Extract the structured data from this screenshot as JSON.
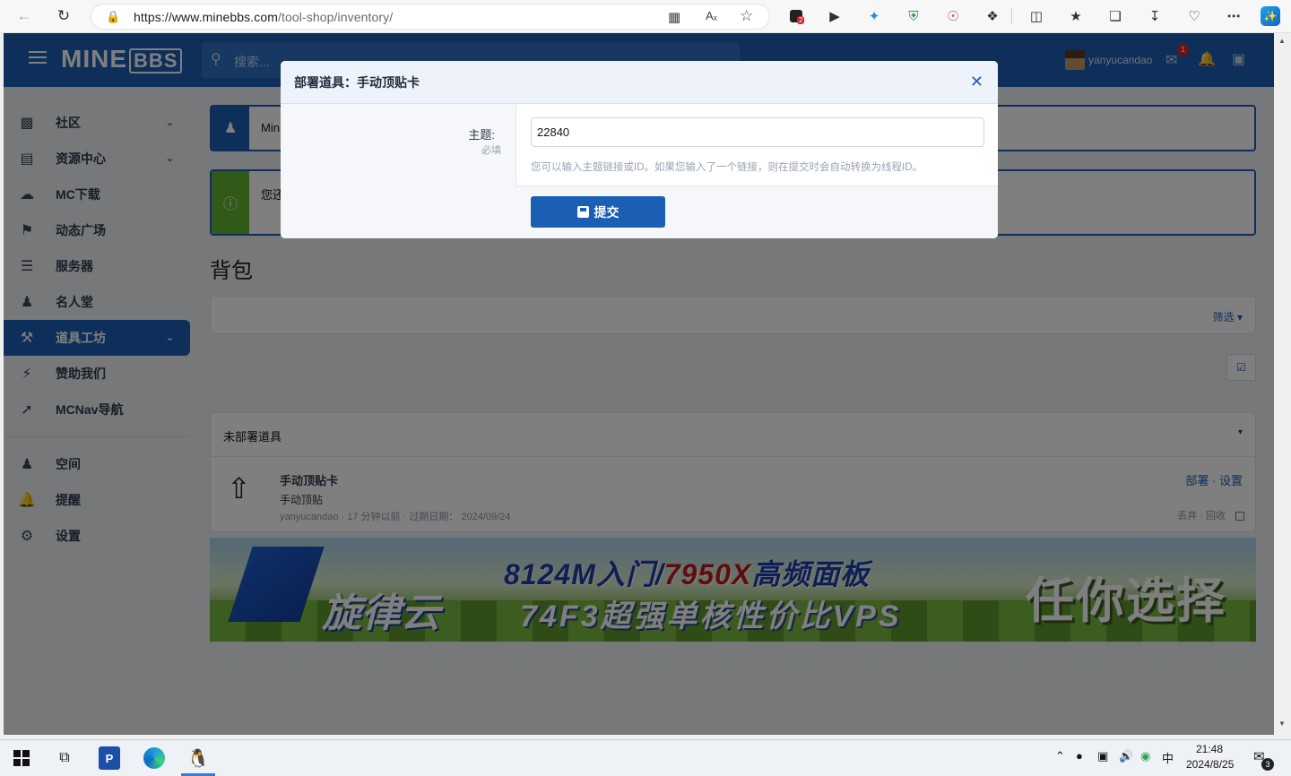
{
  "browser": {
    "url_host": "https://www.minebbs.com",
    "url_path": "/tool-shop/inventory/",
    "ext_badge": "2"
  },
  "header": {
    "logo_main": "MINE",
    "logo_box": "BBS",
    "search_placeholder": "搜索...",
    "username": "yanyucandao",
    "mail_badge": "1"
  },
  "sidebar": {
    "items": [
      {
        "label": "社区"
      },
      {
        "label": "资源中心"
      },
      {
        "label": "MC下载"
      },
      {
        "label": "动态广场"
      },
      {
        "label": "服务器"
      },
      {
        "label": "名人堂"
      },
      {
        "label": "道具工坊"
      },
      {
        "label": "赞助我们"
      },
      {
        "label": "MCNav导航"
      }
    ],
    "account": [
      {
        "label": "空间"
      },
      {
        "label": "提醒"
      },
      {
        "label": "设置"
      }
    ]
  },
  "main": {
    "notice1_text": "Min",
    "notice2_text": "您还",
    "page_title": "背包",
    "filter_label": "筛选",
    "section_title": "未部署道具",
    "item": {
      "name": "手动顶贴卡",
      "desc": "手动顶贴",
      "meta_user": "yanyucandao",
      "meta_time": "17 分钟以前",
      "meta_expire_label": "过期日期：",
      "meta_expire": "2024/09/24",
      "action_deploy": "部署",
      "action_settings": "设置",
      "action_discard": "丢弃",
      "action_recycle": "回收"
    },
    "banner": {
      "line1a": "8124M入门/",
      "line1b": "7950X",
      "line1c": "高频面板",
      "line2": "74F3超强单核性价比VPS",
      "brand": "旋律云",
      "slogan": "任你选择"
    }
  },
  "modal": {
    "title": "部署道具：手动顶贴卡",
    "field_label": "主题:",
    "required": "必填",
    "input_value": "22840",
    "hint": "您可以输入主题链接或ID。如果您输入了一个链接，则在提交时会自动转换为线程ID。",
    "submit_label": "提交"
  },
  "taskbar": {
    "time": "21:48",
    "date": "2024/8/25",
    "ime": "中",
    "notif_count": "3"
  }
}
